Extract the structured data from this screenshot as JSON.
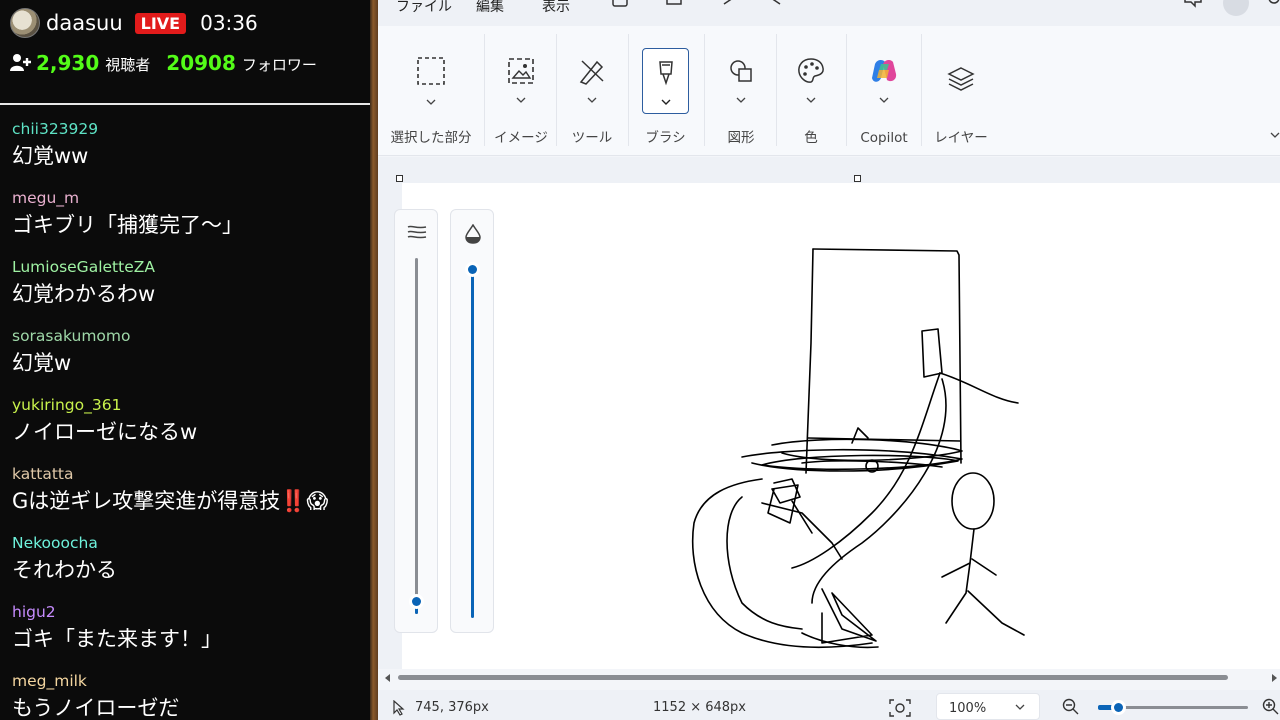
{
  "stream": {
    "streamer_name": "daasuu",
    "live_label": "LIVE",
    "elapsed": "03:36",
    "viewers_count": "2,930",
    "viewers_label": "視聴者",
    "followers_count": "20908",
    "followers_label": "フォロワー"
  },
  "chat": [
    {
      "user": "chii323929",
      "user_color": "#5ee3c5",
      "text": "幻覚ww"
    },
    {
      "user": "megu_m",
      "user_color": "#e9b0cf",
      "text": "ゴキブリ「捕獲完了～」"
    },
    {
      "user": "LumioseGaletteZA",
      "user_color": "#9ff2a3",
      "text": "幻覚わかるわw"
    },
    {
      "user": "sorasakumomo",
      "user_color": "#9fd8a8",
      "text": "幻覚w"
    },
    {
      "user": "yukiringo_361",
      "user_color": "#c8f24c",
      "text": "ノイローゼになるw"
    },
    {
      "user": "kattatta",
      "user_color": "#e0c8a8",
      "text": "Gは逆ギレ攻撃突進が得意技‼️😱"
    },
    {
      "user": "Nekooocha",
      "user_color": "#6ef2dc",
      "text": "それわかる"
    },
    {
      "user": "higu2",
      "user_color": "#c78cff",
      "text": "ゴキ「また来ます！」"
    },
    {
      "user": "meg_milk",
      "user_color": "#f4d6a0",
      "text": "もうノイローゼだ"
    }
  ],
  "paint": {
    "menu": [
      "ファイル",
      "編集",
      "表示"
    ],
    "ribbon_groups": [
      {
        "label": "選択した部分",
        "icon": "selection-icon"
      },
      {
        "label": "イメージ",
        "icon": "image-icon"
      },
      {
        "label": "ツール",
        "icon": "tools-icon"
      },
      {
        "label": "ブラシ",
        "icon": "brush-icon",
        "selected": true
      },
      {
        "label": "図形",
        "icon": "shapes-icon"
      },
      {
        "label": "色",
        "icon": "palette-icon"
      },
      {
        "label": "Copilot",
        "icon": "copilot-icon"
      },
      {
        "label": "レイヤー",
        "icon": "layers-icon"
      }
    ],
    "size_slider_value": 0.05,
    "opacity_slider_value": 0.95,
    "status": {
      "cursor_position": "745, 376px",
      "canvas_size": "1152 × 648px",
      "zoom": "100%"
    },
    "colors": {
      "accent": "#0a64b7",
      "live_red": "#e21b1b",
      "count_green": "#53fc18"
    }
  }
}
